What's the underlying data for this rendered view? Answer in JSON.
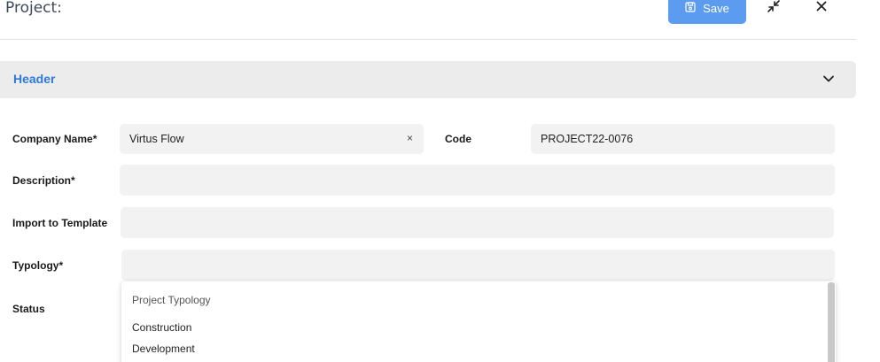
{
  "header": {
    "title": "Project:",
    "save_label": "Save"
  },
  "section": {
    "title": "Header"
  },
  "form": {
    "company_name_label": "Company Name*",
    "company_name_value": "Virtus Flow",
    "clear_symbol": "×",
    "code_label": "Code",
    "code_value": "PROJECT22-0076",
    "description_label": "Description*",
    "description_value": "",
    "import_template_label": "Import to Template",
    "import_template_value": "",
    "typology_label": "Typology*",
    "typology_value": "",
    "status_label": "Status"
  },
  "typology_dropdown": {
    "header": "Project Typology",
    "options": [
      "Construction",
      "Development"
    ]
  },
  "colors": {
    "accent": "#2f7ad6",
    "save_button": "#5b9bf0",
    "field_bg": "#f2f2f2",
    "section_bg": "#ececec"
  },
  "icons": {
    "save": "floppy-disk-icon",
    "minimize": "collapse-arrows-icon",
    "close": "close-icon",
    "chevron": "chevron-down-icon"
  }
}
